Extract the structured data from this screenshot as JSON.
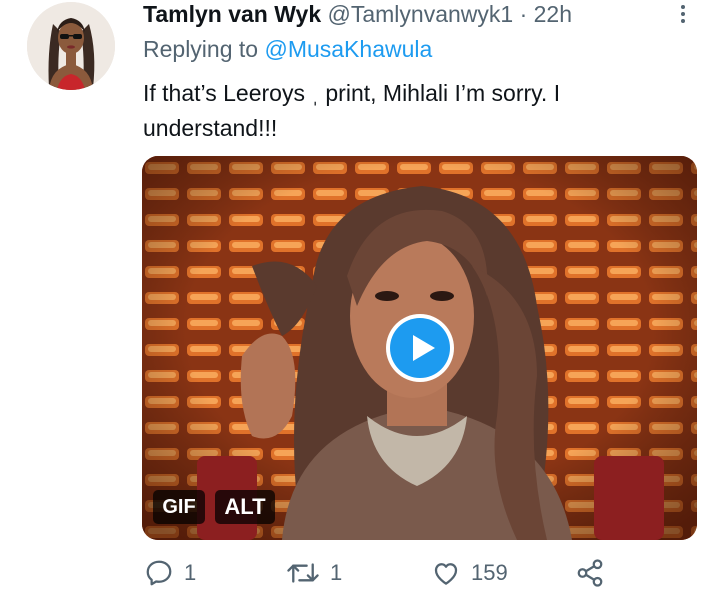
{
  "tweet": {
    "author_name": "Tamlyn van Wyk",
    "author_handle": "@Tamlynvanwyk1",
    "separator": "·",
    "timestamp": "22h",
    "reply_prefix": "Replying to",
    "reply_mention": "@MusaKhawula",
    "text_line1": "If that’s Leeroys  ˌ print, Mihlali I’m sorry. I",
    "text_line2": "understand!!!",
    "media": {
      "type": "gif",
      "gif_badge": "GIF",
      "alt_badge": "ALT",
      "play_icon": "play-icon"
    },
    "actions": {
      "reply_count": "1",
      "retweet_count": "1",
      "like_count": "159"
    }
  },
  "colors": {
    "name": "#0f1419",
    "secondary": "#536471",
    "link": "#1d9bf0",
    "play_button": "#1d9bf0"
  }
}
